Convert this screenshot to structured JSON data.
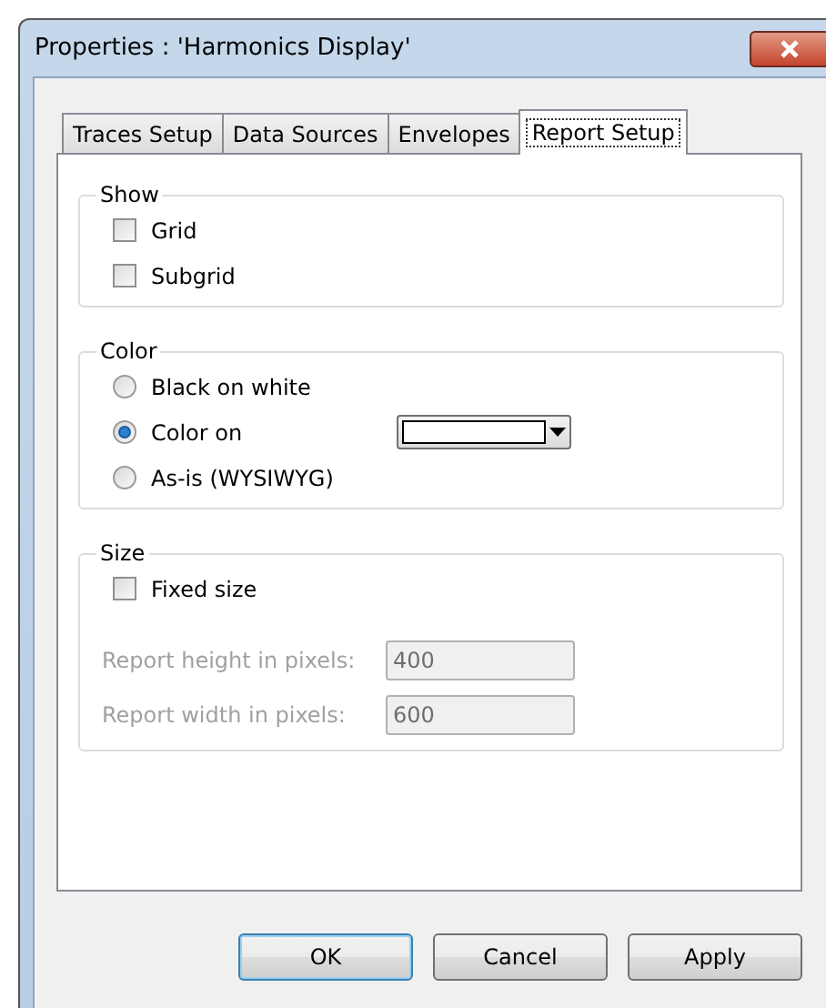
{
  "window": {
    "title": "Properties : 'Harmonics Display'"
  },
  "tabs": [
    {
      "label": "Traces Setup",
      "selected": false
    },
    {
      "label": "Data Sources",
      "selected": false
    },
    {
      "label": "Envelopes",
      "selected": false
    },
    {
      "label": "Report Setup",
      "selected": true
    }
  ],
  "show": {
    "title": "Show",
    "options": [
      {
        "label": "Grid",
        "checked": false
      },
      {
        "label": "Subgrid",
        "checked": false
      }
    ]
  },
  "color": {
    "title": "Color",
    "options": [
      {
        "label": "Black on white",
        "selected": false
      },
      {
        "label": "Color on",
        "selected": true
      },
      {
        "label": "As-is (WYSIWYG)",
        "selected": false
      }
    ]
  },
  "size": {
    "title": "Size",
    "fixed": {
      "label": "Fixed size",
      "checked": false
    },
    "fields": [
      {
        "label": "Report height in pixels:",
        "value": "400",
        "disabled": true
      },
      {
        "label": "Report width in pixels:",
        "value": "600",
        "disabled": true
      }
    ]
  },
  "buttons": [
    {
      "label": "OK",
      "default": true
    },
    {
      "label": "Cancel",
      "default": false
    },
    {
      "label": "Apply",
      "default": false
    }
  ]
}
